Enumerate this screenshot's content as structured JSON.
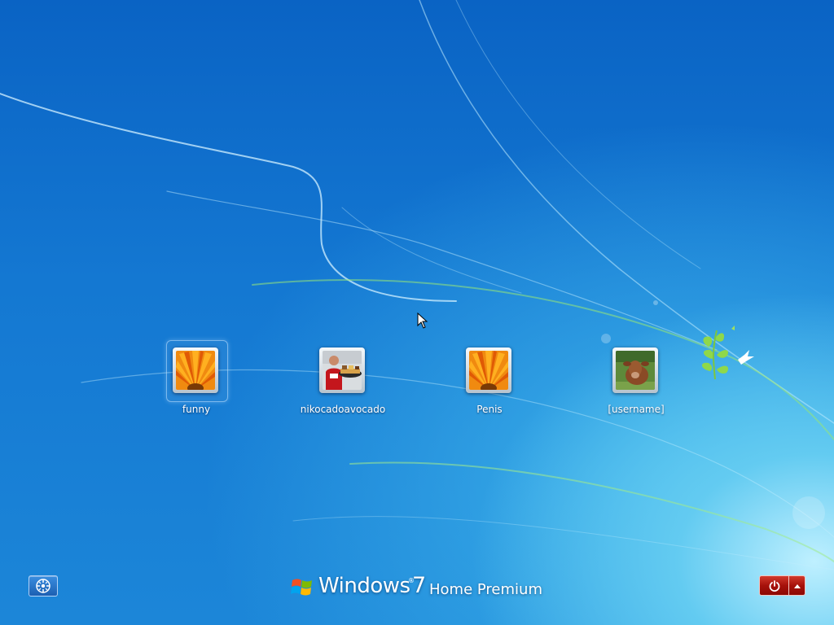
{
  "users": [
    {
      "name": "funny",
      "avatar": "orange-flower-avatar",
      "selected": true
    },
    {
      "name": "nikocadoavocado",
      "avatar": "person-with-food-avatar",
      "selected": false
    },
    {
      "name": "Penis",
      "avatar": "orange-flower-avatar",
      "selected": false
    },
    {
      "name": "[username]",
      "avatar": "cow-avatar",
      "selected": false
    }
  ],
  "branding": {
    "word": "Windows",
    "version": "7",
    "edition": "Home Premium"
  },
  "controls": {
    "ease_of_access_icon": "ease-of-access-icon",
    "power_icon": "power-icon",
    "power_options_icon": "up-arrow-icon"
  },
  "colors": {
    "background": "#1478d2",
    "power_button": "#a6110b",
    "access_button": "#1c5fb2"
  }
}
